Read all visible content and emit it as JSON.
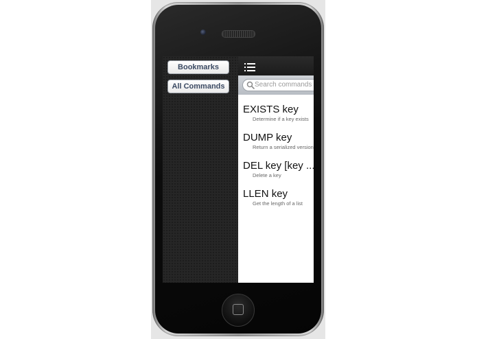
{
  "sidebar": {
    "bookmarks_label": "Bookmarks",
    "all_commands_label": "All Commands"
  },
  "navbar": {
    "menu_icon": "list-menu-icon"
  },
  "search": {
    "placeholder": "Search commands w"
  },
  "commands": [
    {
      "title": "EXISTS key",
      "description": "Determine if a key exists"
    },
    {
      "title": "DUMP key",
      "description": "Return a serialized version"
    },
    {
      "title": "DEL key [key ...]",
      "description": "Delete a key"
    },
    {
      "title": "LLEN key",
      "description": "Get the length of a list"
    }
  ],
  "colors": {
    "button_text": "#3b4a63",
    "navbar": "#1f1f1f",
    "sidebar": "#262626"
  }
}
